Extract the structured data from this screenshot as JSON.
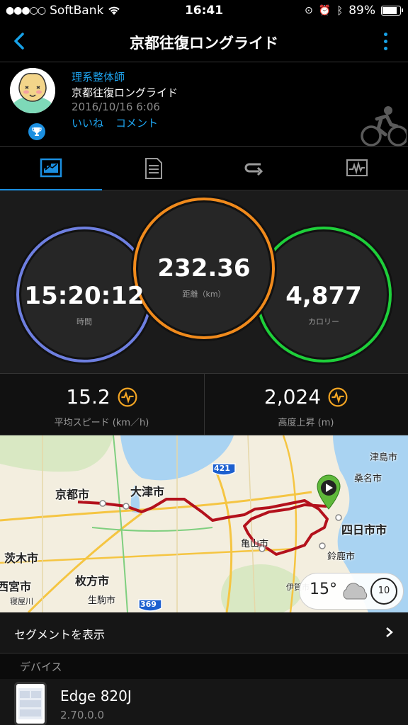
{
  "status_bar": {
    "carrier": "SoftBank",
    "time": "16:41",
    "battery": "89%",
    "battery_level": 0.89
  },
  "header": {
    "title": "京都往復ロングライド"
  },
  "activity": {
    "user_name": "理系整体師",
    "activity_name": "京都往復ロングライド",
    "datetime": "2016/10/16 6:06",
    "like_label": "いいね",
    "comment_label": "コメント",
    "sport_icon": "cycling-icon"
  },
  "tabs": [
    {
      "name": "summary",
      "icon": "chart-icon",
      "active": true
    },
    {
      "name": "details",
      "icon": "document-icon",
      "active": false
    },
    {
      "name": "laps",
      "icon": "loop-icon",
      "active": false
    },
    {
      "name": "graphs",
      "icon": "graph-icon",
      "active": false
    }
  ],
  "metrics": {
    "time": {
      "value": "15:20:12",
      "label": "時間",
      "color": "#6e7fe0"
    },
    "distance": {
      "value": "232.36",
      "label": "距離（km）",
      "color": "#f08a1c"
    },
    "calories": {
      "value": "4,877",
      "label": "カロリー",
      "color": "#1ecf3a"
    }
  },
  "stats": {
    "avg_speed": {
      "value": "15.2",
      "label": "平均スピード (km／h)"
    },
    "elevation_gain": {
      "value": "2,024",
      "label": "高度上昇 (m)"
    }
  },
  "map": {
    "cities": [
      "京都市",
      "大津市",
      "亀山市",
      "四日市市",
      "鈴鹿市",
      "津島市",
      "桑名市",
      "茨木市",
      "枚方市",
      "生駒市",
      "西宮市",
      "寝屋川",
      "伊賀市"
    ],
    "road_labels": [
      "421",
      "369"
    ],
    "weather": {
      "temp": "15°",
      "wind": "10"
    },
    "route_color": "#b3111c"
  },
  "segments": {
    "label": "セグメントを表示"
  },
  "device_section": {
    "title": "デバイス",
    "device_name": "Edge 820J",
    "version": "2.70.0.0"
  }
}
